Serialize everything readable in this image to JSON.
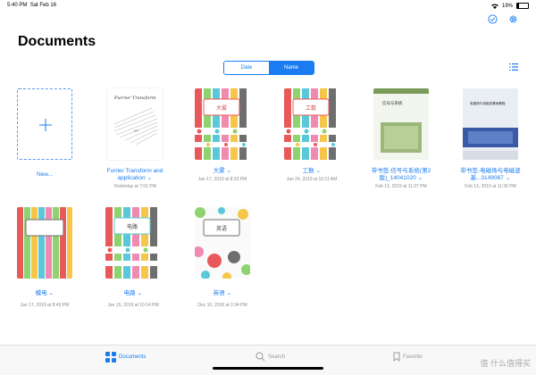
{
  "status": {
    "time": "5:40 PM",
    "date": "Sat Feb 16",
    "battery": "19%"
  },
  "header": {
    "title": "Documents"
  },
  "sort": {
    "date_label": "Date",
    "name_label": "Name",
    "selected": "Name"
  },
  "new_item": {
    "label": "New..."
  },
  "documents": [
    {
      "name": "Furrier Transform and application",
      "date": "Yesterday at 7:01 PM",
      "cover_text": "Furrier Transform"
    },
    {
      "name": "大雾",
      "date": "Jan 17, 2019 at 8:33 PM",
      "cover_text": "大雾"
    },
    {
      "name": "工数",
      "date": "Jan 24, 2019 at 10:11 AM",
      "cover_text": "工数"
    },
    {
      "name": "带书签-信号与系统(第2版)_14041020",
      "date": "Feb 13, 2019 at 11:27 PM",
      "cover_text": "信号与系统"
    },
    {
      "name": "带书签-电磁场与电磁波基...3149087",
      "date": "Feb 13, 2019 at 11:30 PM",
      "cover_text": "电磁场与电磁波基础教程"
    },
    {
      "name": "模电",
      "date": "Jan 17, 2019 at 8:49 PM"
    },
    {
      "name": "电路",
      "date": "Jan 15, 2019 at 10:14 PM",
      "cover_text": "电路"
    },
    {
      "name": "英语",
      "date": "Dec 10, 2018 at 2:34 PM",
      "cover_text": "英语"
    }
  ],
  "tabs": [
    {
      "label": "Documents"
    },
    {
      "label": "Search"
    },
    {
      "label": "Favorite"
    }
  ],
  "watermark": "值 什么值得买",
  "colors": {
    "accent": "#1a7cf0"
  }
}
